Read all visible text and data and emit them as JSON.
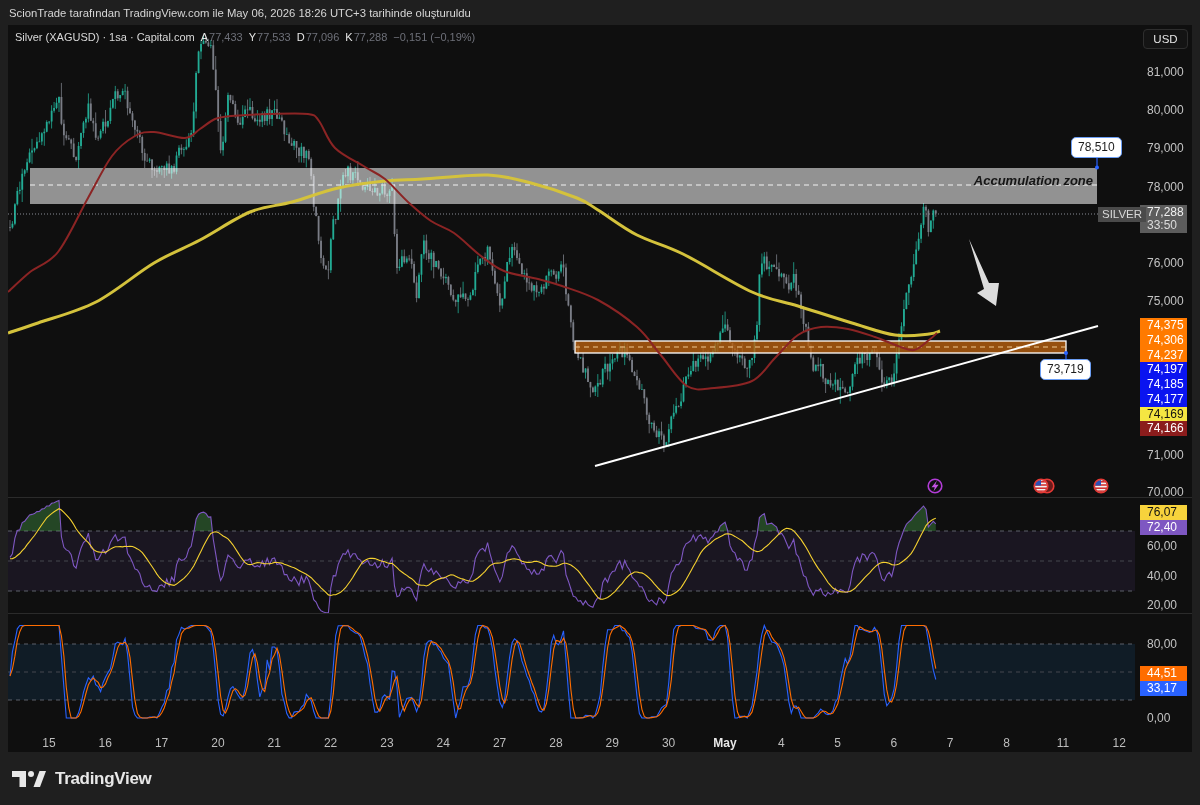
{
  "header": {
    "text": "ScionTrade tarafından TradingView.com ile May 06, 2026 18:26 UTC+3 tarihinde oluşturuldu"
  },
  "legend": {
    "symbol": "Silver (XAGUSD) · 1sa · Capital.com",
    "ohlc": [
      {
        "label": "A",
        "value": "77,433"
      },
      {
        "label": "Y",
        "value": "77,533"
      },
      {
        "label": "D",
        "value": "77,096"
      },
      {
        "label": "K",
        "value": "77,288"
      }
    ],
    "change": "−0,151 (−0,19%)"
  },
  "currency_button": "USD",
  "main_pane": {
    "zone_label": "Accumulation zone",
    "price_labels": [
      "78,510",
      "73,719"
    ],
    "symbol_tag": "SILVER",
    "last_price": {
      "price": "77,288",
      "countdown": "33:50"
    },
    "axis_ticks": [
      "81,000",
      "80,000",
      "79,000",
      "78,000",
      "76,000",
      "75,000",
      "71,000",
      "70,000"
    ],
    "axis_tags": [
      {
        "label": "74,375",
        "color": "#ff7a00"
      },
      {
        "label": "74,306",
        "color": "#ff7a00"
      },
      {
        "label": "74,237",
        "color": "#ff7a00"
      },
      {
        "label": "74,197",
        "color": "#0a14f0"
      },
      {
        "label": "74,185",
        "color": "#0a14f0"
      },
      {
        "label": "74,177",
        "color": "#0a14f0"
      },
      {
        "label": "74,169",
        "color": "#f5e642"
      },
      {
        "label": "74,166",
        "color": "#8b1c1c"
      }
    ]
  },
  "rsi_pane": {
    "axis_ticks": [
      "60,00",
      "40,00",
      "20,00"
    ],
    "axis_tags": [
      {
        "label": "76,07",
        "color": "#f7d33c"
      },
      {
        "label": "72,40",
        "color": "#7e57c2"
      }
    ]
  },
  "stoch_pane": {
    "axis_ticks": [
      "80,00",
      "0,00"
    ],
    "axis_tags": [
      {
        "label": "44,51",
        "color": "#ff6d00"
      },
      {
        "label": "33,17",
        "color": "#2962ff"
      }
    ]
  },
  "time_axis": [
    {
      "label": "15",
      "kind": "day"
    },
    {
      "label": "16",
      "kind": "day"
    },
    {
      "label": "17",
      "kind": "day"
    },
    {
      "label": "20",
      "kind": "day"
    },
    {
      "label": "21",
      "kind": "day"
    },
    {
      "label": "22",
      "kind": "day"
    },
    {
      "label": "23",
      "kind": "day"
    },
    {
      "label": "24",
      "kind": "day"
    },
    {
      "label": "27",
      "kind": "day"
    },
    {
      "label": "28",
      "kind": "day"
    },
    {
      "label": "29",
      "kind": "day"
    },
    {
      "label": "30",
      "kind": "day"
    },
    {
      "label": "May",
      "kind": "month"
    },
    {
      "label": "4",
      "kind": "day"
    },
    {
      "label": "5",
      "kind": "day"
    },
    {
      "label": "6",
      "kind": "day"
    },
    {
      "label": "7",
      "kind": "day"
    },
    {
      "label": "8",
      "kind": "day"
    },
    {
      "label": "11",
      "kind": "day"
    },
    {
      "label": "12",
      "kind": "day"
    }
  ],
  "footer": {
    "logo_text": "TradingView"
  }
}
